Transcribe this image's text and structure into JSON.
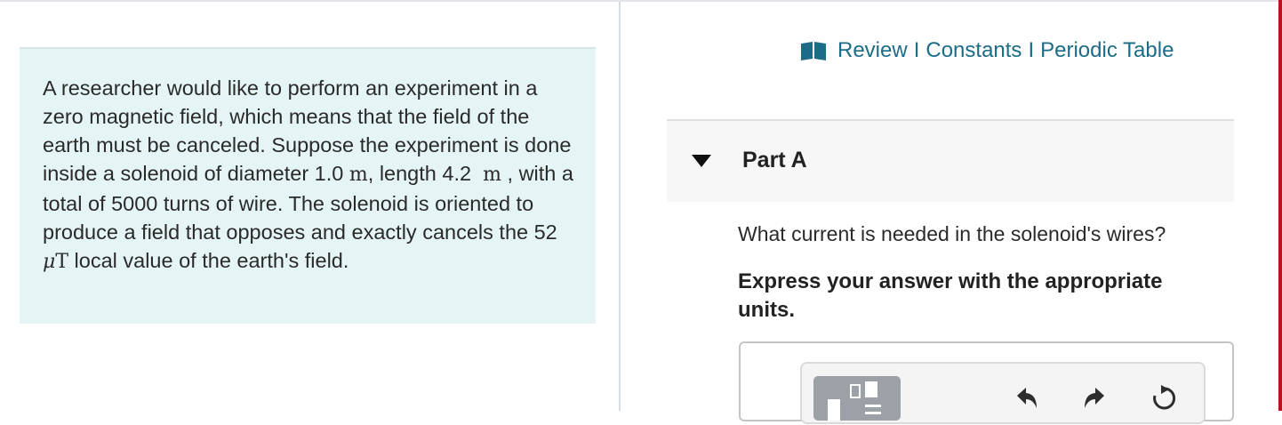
{
  "problem": {
    "seg1": "A researcher would like to perform an experiment in a zero magnetic field, which means that the field of the earth must be canceled. Suppose the experiment is done inside a solenoid of diameter 1.0",
    "unit_m1": "m",
    "seg2": ", length 4.2",
    "unit_m2": "m",
    "seg3": ", with a total of 5000 turns of wire. The solenoid is oriented to produce a field that opposes and exactly cancels the 52",
    "unit_mu": "μ",
    "unit_T": "T",
    "seg4": " local value of the earth's field."
  },
  "header": {
    "icon": "book-icon",
    "links": [
      "Review",
      "Constants",
      "Periodic Table"
    ],
    "separator": "I"
  },
  "part": {
    "title": "Part A",
    "question": "What current is needed in the solenoid's wires?",
    "instruction": "Express your answer with the appropriate units."
  },
  "toolbar": {
    "icons": [
      "templates-icon",
      "undo-icon",
      "redo-icon",
      "reset-icon"
    ]
  },
  "colors": {
    "link": "#1c6c88",
    "problem_bg": "#e5f5f5",
    "part_bg": "#f7f7f7",
    "accent_edge": "#b8141e"
  }
}
